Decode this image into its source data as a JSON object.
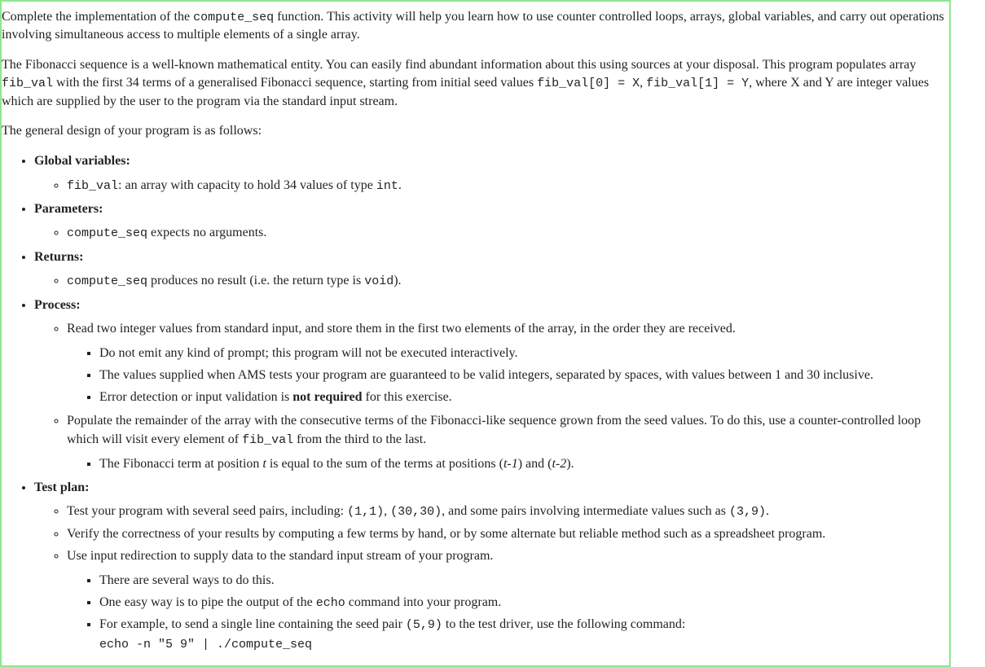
{
  "intro": {
    "p1_a": "Complete the implementation of the ",
    "p1_code": "compute_seq",
    "p1_b": " function. This activity will help you learn how to use counter controlled loops, arrays, global variables, and carry out operations involving simultaneous access to multiple elements of a single array.",
    "p2_a": "The Fibonacci sequence is a well-known mathematical entity. You can easily find abundant information about this using sources at your disposal. This program populates array ",
    "p2_code1": "fib_val",
    "p2_b": " with the first 34 terms of a generalised Fibonacci sequence, starting from initial seed values ",
    "p2_code2": "fib_val[0] = X",
    "p2_c": ", ",
    "p2_code3": "fib_val[1] = Y",
    "p2_d": ", where X and Y are integer values which are supplied by the user to the program via the standard input stream.",
    "p3": "The general design of your program is as follows:"
  },
  "sections": {
    "globals": {
      "heading": "Global variables:",
      "item1_code": "fib_val",
      "item1_a": ": an array with capacity to hold 34 values of type ",
      "item1_code2": "int",
      "item1_b": "."
    },
    "params": {
      "heading": "Parameters:",
      "item1_code": "compute_seq",
      "item1_a": " expects no arguments."
    },
    "returns": {
      "heading": "Returns:",
      "item1_code": "compute_seq",
      "item1_a": " produces no result (i.e. the return type is ",
      "item1_code2": "void",
      "item1_b": ")."
    },
    "process": {
      "heading": "Process:",
      "p1": "Read two integer values from standard input, and store them in the first two elements of the array, in the order they are received.",
      "p1_s1": "Do not emit any kind of prompt; this program will not be executed interactively.",
      "p1_s2": "The values supplied when AMS tests your program are guaranteed to be valid integers, separated by spaces, with values between 1 and 30 inclusive.",
      "p1_s3_a": "Error detection or input validation is ",
      "p1_s3_bold": "not required",
      "p1_s3_b": " for this exercise.",
      "p2_a": "Populate the remainder of the array with the consecutive terms of the Fibonacci-like sequence grown from the seed values. To do this, use a counter-controlled loop which will visit every element of ",
      "p2_code": "fib_val",
      "p2_b": " from the third to the last.",
      "p2_s1_a": "The Fibonacci term at position ",
      "p2_s1_i1": "t",
      "p2_s1_b": " is equal to the sum of the terms at positions (",
      "p2_s1_i2": "t-1",
      "p2_s1_c": ") and (",
      "p2_s1_i3": "t-2",
      "p2_s1_d": ")."
    },
    "testplan": {
      "heading": "Test plan:",
      "t1_a": "Test your program with several seed pairs, including: ",
      "t1_code1": "(1,1)",
      "t1_b": ", ",
      "t1_code2": "(30,30)",
      "t1_c": ", and some pairs involving intermediate values such as ",
      "t1_code3": "(3,9)",
      "t1_d": ".",
      "t2": "Verify the correctness of your results by computing a few terms by hand, or by some alternate but reliable method such as a spreadsheet program.",
      "t3": "Use input redirection to supply data to the standard input stream of your program.",
      "t3_s1": "There are several ways to do this.",
      "t3_s2_a": "One easy way is to pipe the output of the ",
      "t3_s2_code": "echo",
      "t3_s2_b": " command into your program.",
      "t3_s3_a": "For example, to send a single line containing the seed pair ",
      "t3_s3_code": "(5,9)",
      "t3_s3_b": " to the test driver, use the following command:",
      "t3_s3_cmd": "echo -n \"5 9\" | ./compute_seq"
    }
  }
}
